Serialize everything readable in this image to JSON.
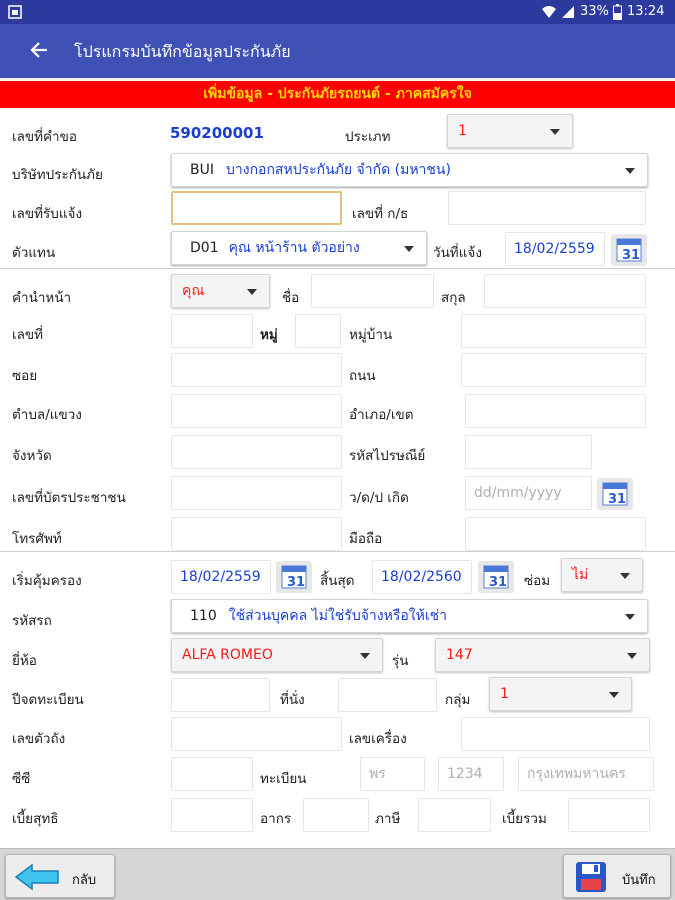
{
  "status": {
    "battery": "33%",
    "time": "13:24"
  },
  "appbar": {
    "title": "โปรแกรมบันทึกข้อมูลประกันภัย"
  },
  "banner": {
    "text": "เพิ่มข้อมูล - ประกันภัยรถยนต์ - ภาคสมัครใจ"
  },
  "form": {
    "request_no_label": "เลขที่คำขอ",
    "request_no": "590200001",
    "type_label": "ประเภท",
    "type_value": "1",
    "company_label": "บริษัทประกันภัย",
    "company_code": "BUI",
    "company_name": "บางกอกสหประกันภัย จำกัด (มหาชน)",
    "notify_no_label": "เลขที่รับแจ้ง",
    "policy_no_label": "เลขที่ ก/ธ",
    "agent_label": "ตัวแทน",
    "agent_code": "D01",
    "agent_name": "คุณ หน้าร้าน ตัวอย่าง",
    "notify_date_label": "วันที่แจ้ง",
    "notify_date": "18/02/2559",
    "title_label": "คำนำหน้า",
    "title_value": "คุณ",
    "first_name_label": "ชื่อ",
    "last_name_label": "สกุล",
    "house_no_label": "เลขที่",
    "moo_label": "หมู่",
    "village_label": "หมู่บ้าน",
    "soi_label": "ซอย",
    "road_label": "ถนน",
    "subdistrict_label": "ตำบล/แขวง",
    "district_label": "อำเภอ/เขต",
    "province_label": "จังหวัด",
    "postcode_label": "รหัสไปรษณีย์",
    "id_card_label": "เลขที่บัตรประชาชน",
    "birthdate_label": "ว/ด/ป เกิด",
    "birthdate_placeholder": "dd/mm/yyyy",
    "phone_label": "โทรศัพท์",
    "mobile_label": "มือถือ",
    "cover_start_label": "เริ่มคุ้มครอง",
    "cover_start": "18/02/2559",
    "cover_end_label": "สิ้นสุด",
    "cover_end": "18/02/2560",
    "repair_label": "ซ่อม",
    "repair_value": "ไม่",
    "car_code_label": "รหัสรถ",
    "car_code": "110",
    "car_code_desc": "ใช้ส่วนบุคคล ไม่ใช่รับจ้างหรือให้เช่า",
    "brand_label": "ยี่ห้อ",
    "brand_value": "ALFA ROMEO",
    "model_label": "รุ่น",
    "model_value": "147",
    "reg_year_label": "ปีจดทะเบียน",
    "seats_label": "ที่นั่ง",
    "group_label": "กลุ่ม",
    "group_value": "1",
    "chassis_label": "เลขตัวถัง",
    "engine_label": "เลขเครื่อง",
    "cc_label": "ซีซี",
    "plate_label": "ทะเบียน",
    "plate_prefix_placeholder": "พร",
    "plate_no_placeholder": "1234",
    "plate_province_placeholder": "กรุงเทพมหานคร",
    "net_premium_label": "เบี้ยสุทธิ",
    "stamp_label": "อากร",
    "tax_label": "ภาษี",
    "total_label": "เบี้ยรวม"
  },
  "buttons": {
    "back": "กลับ",
    "save": "บันทึก"
  },
  "colors": {
    "appbar": "#3f51b5",
    "banner_bg": "#ff0000",
    "banner_text": "#ffd600",
    "value_blue": "#1a3fd0",
    "value_red": "#ff1a1a"
  },
  "calendar_icon_text": "31"
}
